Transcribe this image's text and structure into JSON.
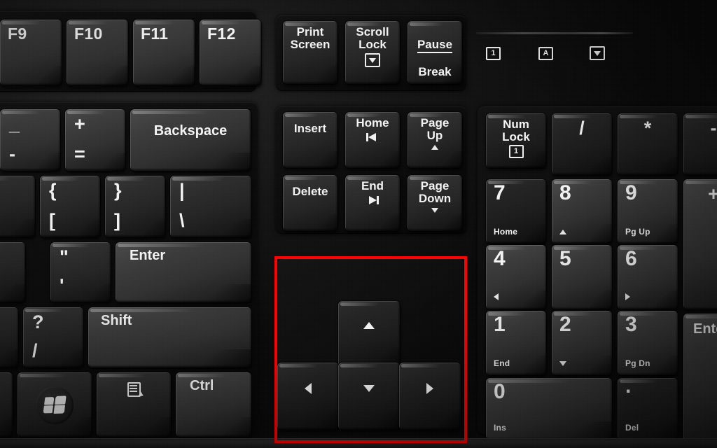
{
  "scene": {
    "subject": "computer-keyboard-closeup",
    "highlight_color": "#ff0000",
    "highlight_target": "arrow-key-cluster"
  },
  "function_row": {
    "keys": [
      {
        "label": "F9"
      },
      {
        "label": "F10"
      },
      {
        "label": "F11"
      },
      {
        "label": "F12"
      }
    ]
  },
  "system_row": {
    "print_screen": {
      "line1": "Print",
      "line2": "Screen"
    },
    "scroll_lock": {
      "line1": "Scroll",
      "line2": "Lock",
      "icon": "boxed-down-arrow-icon"
    },
    "pause_break": {
      "line1": "Pause",
      "line2": "Break"
    }
  },
  "indicators": {
    "num_lock": {
      "glyph": "1",
      "icon": "num-lock-led-icon"
    },
    "caps_lock": {
      "glyph": "A",
      "icon": "caps-lock-led-icon"
    },
    "scroll_lock": {
      "glyph": "↓",
      "icon": "scroll-lock-led-icon"
    }
  },
  "main_block": {
    "minus_key": {
      "shift": "_",
      "base": "-"
    },
    "equals_key": {
      "shift": "+",
      "base": "="
    },
    "backspace": {
      "label": "Backspace"
    },
    "bracket_left": {
      "shift": "{",
      "base": "["
    },
    "bracket_right": {
      "shift": "}",
      "base": "]"
    },
    "backslash": {
      "shift": "|",
      "base": "\\"
    },
    "semicolon": {
      "shift": ":",
      "base": ";"
    },
    "quote": {
      "shift": "\"",
      "base": "'"
    },
    "enter": {
      "label": "Enter"
    },
    "slash": {
      "shift": "?",
      "base": "/"
    },
    "shift": {
      "label": "Shift"
    },
    "windows": {
      "icon": "windows-logo-icon"
    },
    "menu": {
      "icon": "context-menu-icon"
    },
    "ctrl": {
      "label": "Ctrl"
    }
  },
  "nav_cluster": {
    "insert": {
      "label": "Insert"
    },
    "home": {
      "label": "Home",
      "icon": "skip-to-start-icon"
    },
    "page_up": {
      "line1": "Page",
      "line2": "Up",
      "icon": "triangle-up-icon"
    },
    "delete": {
      "label": "Delete"
    },
    "end": {
      "label": "End",
      "icon": "skip-to-end-icon"
    },
    "page_down": {
      "line1": "Page",
      "line2": "Down",
      "icon": "triangle-down-icon"
    }
  },
  "arrow_cluster": {
    "up": {
      "icon": "arrow-up-icon"
    },
    "left": {
      "icon": "arrow-left-icon"
    },
    "down": {
      "icon": "arrow-down-icon"
    },
    "right": {
      "icon": "arrow-right-icon"
    }
  },
  "numpad": {
    "num_lock": {
      "line1": "Num",
      "line2": "Lock",
      "glyph": "1"
    },
    "divide": {
      "label": "/"
    },
    "multiply": {
      "label": "*"
    },
    "subtract": {
      "label": "-"
    },
    "seven": {
      "num": "7",
      "alt": "Home"
    },
    "eight": {
      "num": "8",
      "alt_icon": "triangle-up-icon"
    },
    "nine": {
      "num": "9",
      "alt": "Pg Up"
    },
    "add": {
      "label": "+"
    },
    "four": {
      "num": "4",
      "alt_icon": "triangle-left-icon"
    },
    "five": {
      "num": "5",
      "alt": ""
    },
    "six": {
      "num": "6",
      "alt_icon": "triangle-right-icon"
    },
    "one": {
      "num": "1",
      "alt": "End"
    },
    "two": {
      "num": "2",
      "alt_icon": "triangle-down-icon"
    },
    "three": {
      "num": "3",
      "alt": "Pg Dn"
    },
    "enter": {
      "label": "Enter"
    },
    "zero": {
      "num": "0",
      "alt": "Ins"
    },
    "decimal": {
      "num": ".",
      "alt": "Del"
    }
  }
}
